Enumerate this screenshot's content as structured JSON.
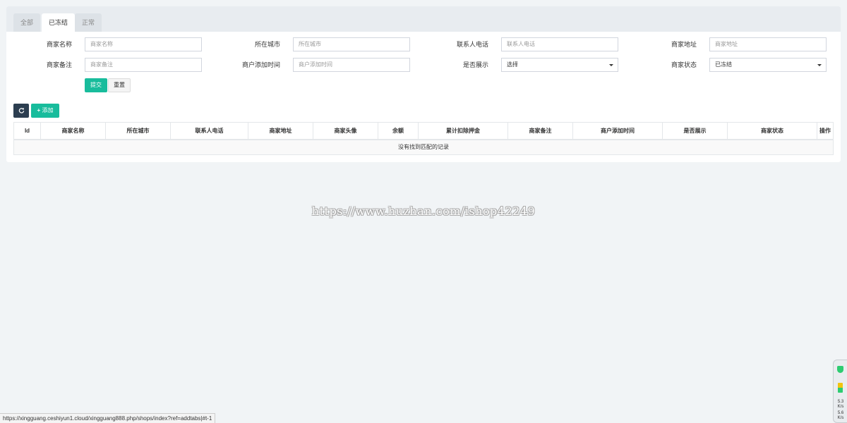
{
  "tabs": [
    {
      "label": "全部",
      "active": false
    },
    {
      "label": "已冻结",
      "active": true
    },
    {
      "label": "正常",
      "active": false
    }
  ],
  "form": {
    "shop_name": {
      "label": "商家名称",
      "placeholder": "商家名称"
    },
    "city": {
      "label": "所在城市",
      "placeholder": "所在城市"
    },
    "phone": {
      "label": "联系人电话",
      "placeholder": "联系人电话"
    },
    "address": {
      "label": "商家地址",
      "placeholder": "商家地址"
    },
    "remark": {
      "label": "商家备注",
      "placeholder": "商家备注"
    },
    "add_time": {
      "label": "商户添加时间",
      "placeholder": "商户添加时间"
    },
    "display": {
      "label": "是否展示",
      "value": "选择"
    },
    "status": {
      "label": "商家状态",
      "value": "已冻结"
    },
    "submit_label": "提交",
    "reset_label": "重置"
  },
  "toolbar": {
    "refresh_icon": "refresh-icon",
    "add_label": "添加"
  },
  "table": {
    "columns": [
      "Id",
      "商家名称",
      "所在城市",
      "联系人电话",
      "商家地址",
      "商家头像",
      "余额",
      "累计扣除押金",
      "商家备注",
      "商户添加时间",
      "是否展示",
      "商家状态",
      "操作"
    ],
    "empty_text": "没有找到匹配的记录"
  },
  "watermark": "https://www.huzhan.com/ishop42249",
  "statusbar": "https://xingguang.ceshiyun1.cloud/xingguang888.php/shops/index?ref=addtabs|#t-1",
  "widget": {
    "line1": "5.3",
    "line1b": "K/s",
    "line2": "5.6",
    "line2b": "K/s"
  },
  "colors": {
    "accent": "#18bc9c",
    "dark": "#2c3e50",
    "bg": "#f1f4f6"
  }
}
